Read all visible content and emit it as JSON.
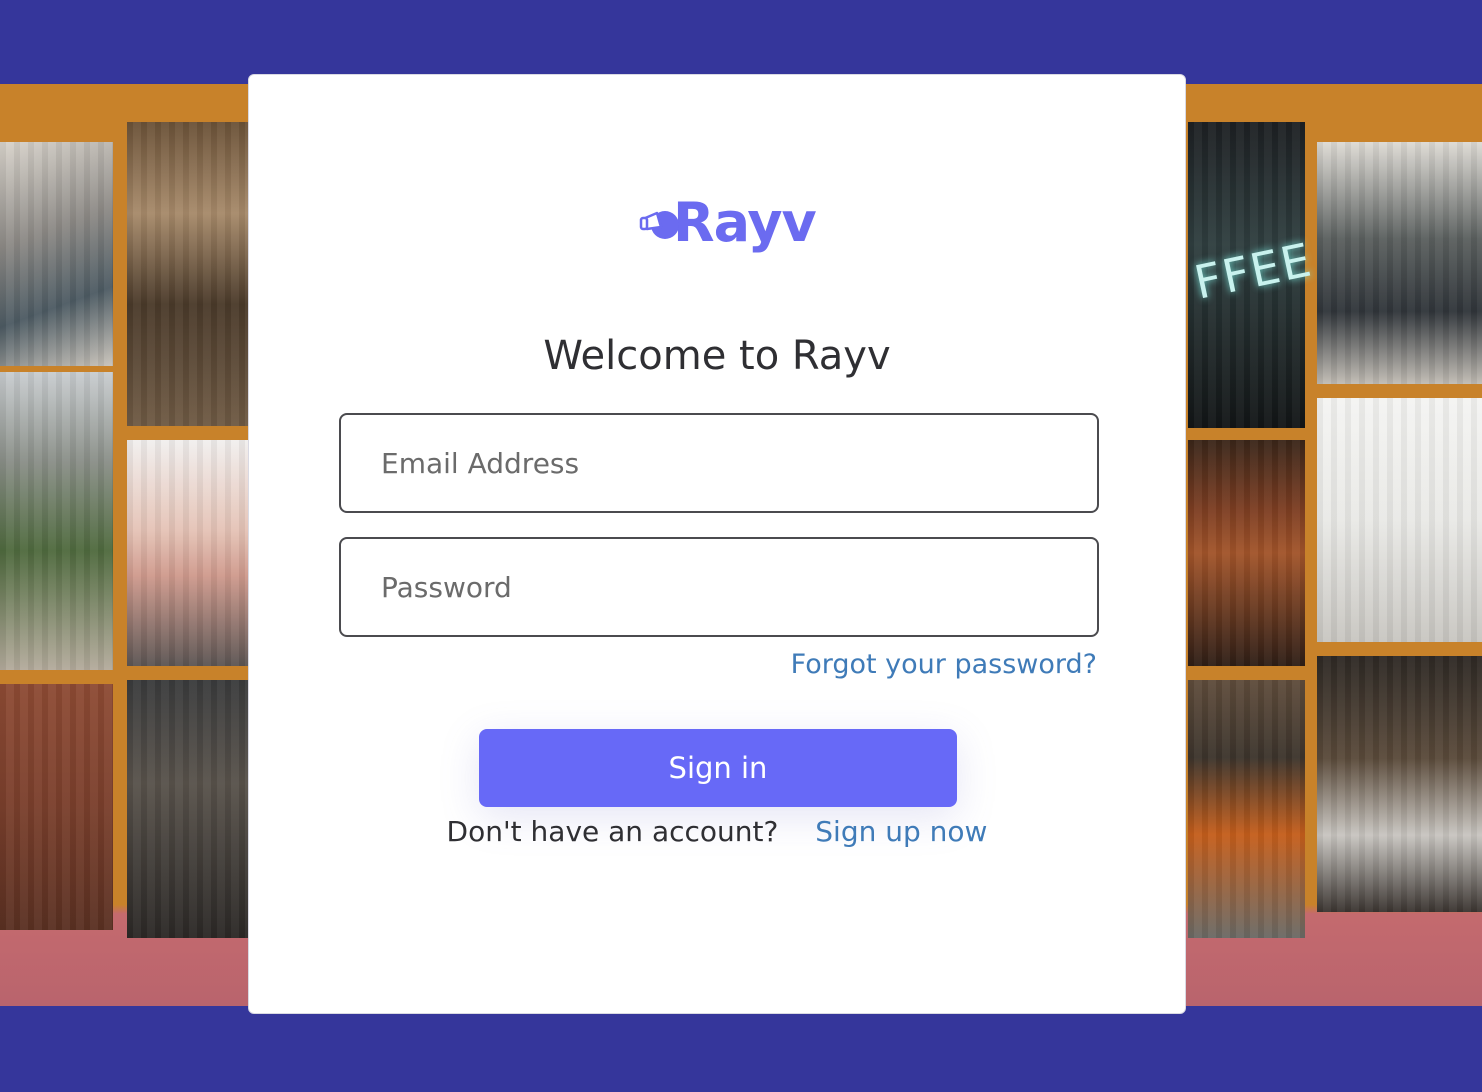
{
  "brand": {
    "name": "Rayv",
    "color": "#6b6bf0"
  },
  "background": {
    "neon_sign_text": "FFEE"
  },
  "login": {
    "title": "Welcome to Rayv",
    "email_placeholder": "Email Address",
    "password_placeholder": "Password",
    "forgot_link": "Forgot your password?",
    "signin_label": "Sign in",
    "no_account_text": "Don't have an account?",
    "signup_link": "Sign up now"
  },
  "colors": {
    "page_bg": "#35369b",
    "collage_bg": "#c8822a",
    "button_bg": "#6769f7",
    "link": "#3f7bb8"
  }
}
